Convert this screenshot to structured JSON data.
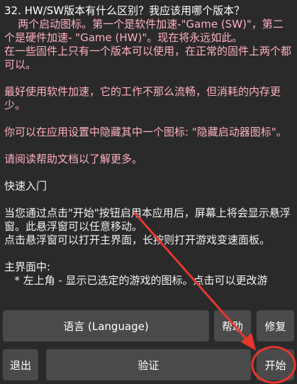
{
  "help": {
    "question": "32. HW/SW版本有什么区别？我应该用哪个版本？",
    "line1": "    两个启动图标。第一个是软件加速-\"Game (SW)\"，第二个是硬件加速- \"Game (HW)\"。现在将永远如此。",
    "line2": "在一些固件上只有一个版本可以使用，在正常的固件上两个都可以。",
    "line3": "最好使用软件加速，它的工作不那么流畅，但消耗的内存更少。",
    "line4": "你可以在应用设置中隐藏其中一个图标: \"隐藏启动器图标\"。",
    "line5": "请阅读帮助文档以了解更多。",
    "quickstart_title": "快速入门",
    "quickstart1": "当您通过点击\"开始\"按钮启用本应用后，屏幕上将会显示悬浮窗。此悬浮窗可以任意移动。",
    "quickstart2": "点击悬浮窗可以打开主界面，长按则打开游戏变速面板。",
    "main_title": "主界面中:",
    "main_item1": "   * 左上角 - 显示已选定的游戏的图标。点击可以更改游"
  },
  "buttons": {
    "language": "语言 (Language)",
    "help": "帮助",
    "repair": "修复",
    "exit": "退出",
    "verify": "验证",
    "start": "开始"
  },
  "colors": {
    "background": "#2a2a2a",
    "button": "#4a4a4a",
    "accent_pink": "#ffb0c0",
    "annotation_red": "#e8362e"
  }
}
